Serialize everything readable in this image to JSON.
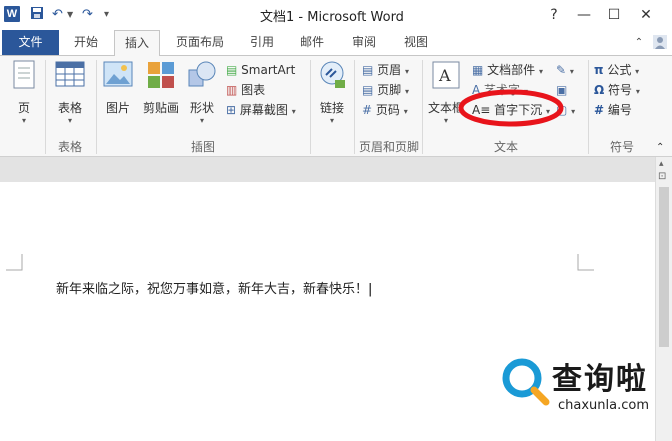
{
  "window": {
    "title": "文档1 - Microsoft Word",
    "app_icon": "W"
  },
  "tabs": {
    "file": "文件",
    "items": [
      "开始",
      "插入",
      "页面布局",
      "引用",
      "邮件",
      "审阅",
      "视图"
    ],
    "active": "插入"
  },
  "ribbon": {
    "pages": {
      "label": "页",
      "group": ""
    },
    "table": {
      "label": "表格",
      "group": "表格"
    },
    "illustrations": {
      "picture": "图片",
      "clipart": "剪贴画",
      "shapes": "形状",
      "smartart": "SmartArt",
      "chart": "图表",
      "screenshot": "屏幕截图",
      "group": "插图"
    },
    "links": {
      "label": "链接"
    },
    "header_footer": {
      "header": "页眉",
      "footer": "页脚",
      "page_number": "页码",
      "group": "页眉和页脚"
    },
    "text": {
      "textbox": "文本框",
      "quickparts": "文档部件",
      "wordart": "艺术字",
      "dropcap": "首字下沉",
      "group": "文本"
    },
    "symbols": {
      "equation": "公式",
      "symbol": "符号",
      "number": "编号",
      "group": "符号"
    }
  },
  "document": {
    "text": "新年来临之际，祝您万事如意，新年大吉，新春快乐！"
  },
  "watermark": {
    "brand": "查询啦",
    "domain": "chaxunla.com"
  },
  "colors": {
    "accent": "#2b579a",
    "highlight_circle": "#e8141b",
    "watermark_blue": "#1a9ad6"
  }
}
